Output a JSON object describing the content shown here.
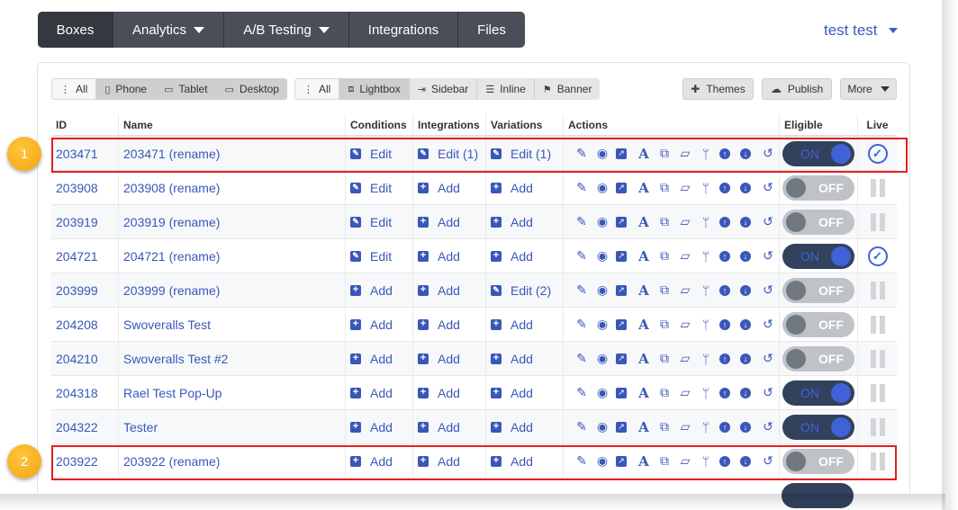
{
  "nav": {
    "items": [
      {
        "label": "Boxes",
        "active": true,
        "dropdown": false,
        "width": 84
      },
      {
        "label": "Analytics",
        "active": false,
        "dropdown": true,
        "width": 123
      },
      {
        "label": "A/B Testing",
        "active": false,
        "dropdown": true,
        "width": 139
      },
      {
        "label": "Integrations",
        "active": false,
        "dropdown": false,
        "width": 121
      },
      {
        "label": "Files",
        "active": false,
        "dropdown": false,
        "width": 74
      }
    ],
    "user": "test test"
  },
  "filters": {
    "device": {
      "all": "All",
      "phone": "Phone",
      "tablet": "Tablet",
      "desktop": "Desktop"
    },
    "type": {
      "all": "All",
      "lightbox": "Lightbox",
      "sidebar": "Sidebar",
      "inline": "Inline",
      "banner": "Banner"
    },
    "themes": "Themes",
    "publish": "Publish",
    "more": "More"
  },
  "table": {
    "headers": {
      "id": "ID",
      "name": "Name",
      "conditions": "Conditions",
      "integrations": "Integrations",
      "variations": "Variations",
      "actions": "Actions",
      "eligible": "Eligible",
      "live": "Live"
    },
    "rows": [
      {
        "id": "203471",
        "name": "203471 (rename)",
        "conditions": "Edit",
        "conditions_mode": "edit",
        "integrations": "Edit (1)",
        "integrations_mode": "edit",
        "variations": "Edit (1)",
        "variations_mode": "edit",
        "eligible": "ON",
        "eligible_on": true,
        "live": true
      },
      {
        "id": "203908",
        "name": "203908 (rename)",
        "conditions": "Edit",
        "conditions_mode": "edit",
        "integrations": "Add",
        "integrations_mode": "add",
        "variations": "Add",
        "variations_mode": "add",
        "eligible": "OFF",
        "eligible_on": false,
        "live": false
      },
      {
        "id": "203919",
        "name": "203919 (rename)",
        "conditions": "Edit",
        "conditions_mode": "edit",
        "integrations": "Add",
        "integrations_mode": "add",
        "variations": "Add",
        "variations_mode": "add",
        "eligible": "OFF",
        "eligible_on": false,
        "live": false
      },
      {
        "id": "204721",
        "name": "204721 (rename)",
        "conditions": "Edit",
        "conditions_mode": "edit",
        "integrations": "Add",
        "integrations_mode": "add",
        "variations": "Add",
        "variations_mode": "add",
        "eligible": "ON",
        "eligible_on": true,
        "live": true
      },
      {
        "id": "203999",
        "name": "203999 (rename)",
        "conditions": "Add",
        "conditions_mode": "add",
        "integrations": "Add",
        "integrations_mode": "add",
        "variations": "Edit (2)",
        "variations_mode": "edit",
        "eligible": "OFF",
        "eligible_on": false,
        "live": false
      },
      {
        "id": "204208",
        "name": "Swoveralls Test",
        "conditions": "Add",
        "conditions_mode": "add",
        "integrations": "Add",
        "integrations_mode": "add",
        "variations": "Add",
        "variations_mode": "add",
        "eligible": "OFF",
        "eligible_on": false,
        "live": false
      },
      {
        "id": "204210",
        "name": "Swoveralls Test #2",
        "conditions": "Add",
        "conditions_mode": "add",
        "integrations": "Add",
        "integrations_mode": "add",
        "variations": "Add",
        "variations_mode": "add",
        "eligible": "OFF",
        "eligible_on": false,
        "live": false
      },
      {
        "id": "204318",
        "name": "Rael Test Pop-Up",
        "conditions": "Add",
        "conditions_mode": "add",
        "integrations": "Add",
        "integrations_mode": "add",
        "variations": "Add",
        "variations_mode": "add",
        "eligible": "ON",
        "eligible_on": true,
        "live": false
      },
      {
        "id": "204322",
        "name": "Tester",
        "conditions": "Add",
        "conditions_mode": "add",
        "integrations": "Add",
        "integrations_mode": "add",
        "variations": "Add",
        "variations_mode": "add",
        "eligible": "ON",
        "eligible_on": true,
        "live": false
      },
      {
        "id": "203922",
        "name": "203922 (rename)",
        "conditions": "Add",
        "conditions_mode": "add",
        "integrations": "Add",
        "integrations_mode": "add",
        "variations": "Add",
        "variations_mode": "add",
        "eligible": "OFF",
        "eligible_on": false,
        "live": false
      }
    ]
  },
  "action_icons": [
    "pencil-icon",
    "eye-icon",
    "external-link-icon",
    "font-icon",
    "copy-icon",
    "folder-icon",
    "fork-icon",
    "arrow-up-circle-icon",
    "arrow-down-circle-icon",
    "undo-icon"
  ],
  "callouts": [
    "1",
    "2"
  ],
  "colors": {
    "link": "#3a57b8",
    "toggle_on_bg": "#32415c",
    "toggle_on_knob": "#3f62d6",
    "toggle_off_bg": "#bfc2c6",
    "highlight": "#e02020",
    "callout": "#f2a514",
    "nav_bg": "#4a4f57"
  }
}
